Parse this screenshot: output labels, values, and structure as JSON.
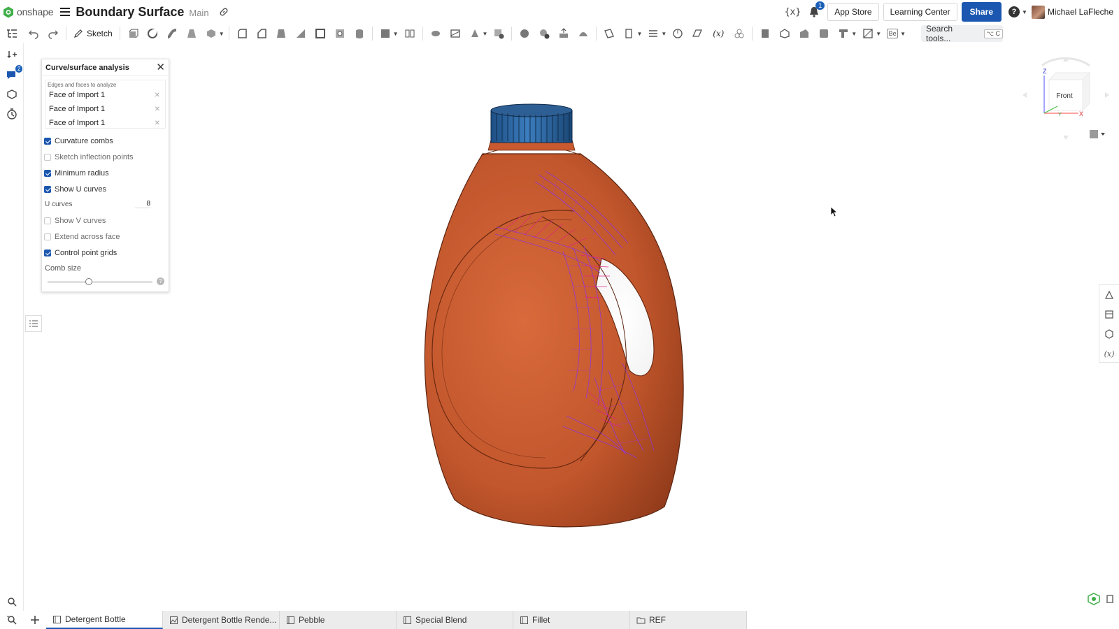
{
  "header": {
    "logo_text": "onshape",
    "document_title": "Boundary Surface",
    "branch": "Main",
    "notification_count": "1",
    "variables_label": "{x}",
    "app_store": "App Store",
    "learning_center": "Learning Center",
    "share": "Share",
    "user_name": "Michael LaFleche"
  },
  "toolbar": {
    "sketch_label": "Sketch",
    "search_placeholder": "Search tools...",
    "search_shortcut": "⌥ C"
  },
  "left_rail": {
    "comments_badge": "2"
  },
  "analysis_panel": {
    "title": "Curve/surface analysis",
    "selection_caption": "Edges and faces to analyze",
    "selections": [
      "Face of Import 1",
      "Face of Import 1",
      "Face of Import 1"
    ],
    "options": [
      {
        "label": "Curvature combs",
        "checked": true
      },
      {
        "label": "Sketch inflection points",
        "checked": false
      },
      {
        "label": "Minimum radius",
        "checked": true
      },
      {
        "label": "Show U curves",
        "checked": true
      }
    ],
    "u_curves_label": "U curves",
    "u_curves_value": "8",
    "options2": [
      {
        "label": "Show V curves",
        "checked": false
      },
      {
        "label": "Extend across face",
        "checked": false
      },
      {
        "label": "Control point grids",
        "checked": true
      }
    ],
    "comb_size_label": "Comb size",
    "comb_size_fraction": 0.39
  },
  "viewcube": {
    "face_label": "Front",
    "axis_z": "Z",
    "axis_x": "X",
    "axis_y": "Y"
  },
  "tabs": [
    {
      "label": "Detergent Bottle",
      "type": "part-studio",
      "active": true
    },
    {
      "label": "Detergent Bottle Rende...",
      "type": "render",
      "active": false
    },
    {
      "label": "Pebble",
      "type": "part-studio",
      "active": false
    },
    {
      "label": "Special Blend",
      "type": "part-studio",
      "active": false
    },
    {
      "label": "Fillet",
      "type": "part-studio",
      "active": false
    },
    {
      "label": "REF",
      "type": "folder",
      "active": false
    }
  ],
  "colors": {
    "accent": "#1b57b0",
    "bottle_body": "#c2562c",
    "bottle_cap": "#2d6aa8",
    "analysis_magenta": "#e0208a",
    "analysis_violet": "#8a33e6"
  }
}
